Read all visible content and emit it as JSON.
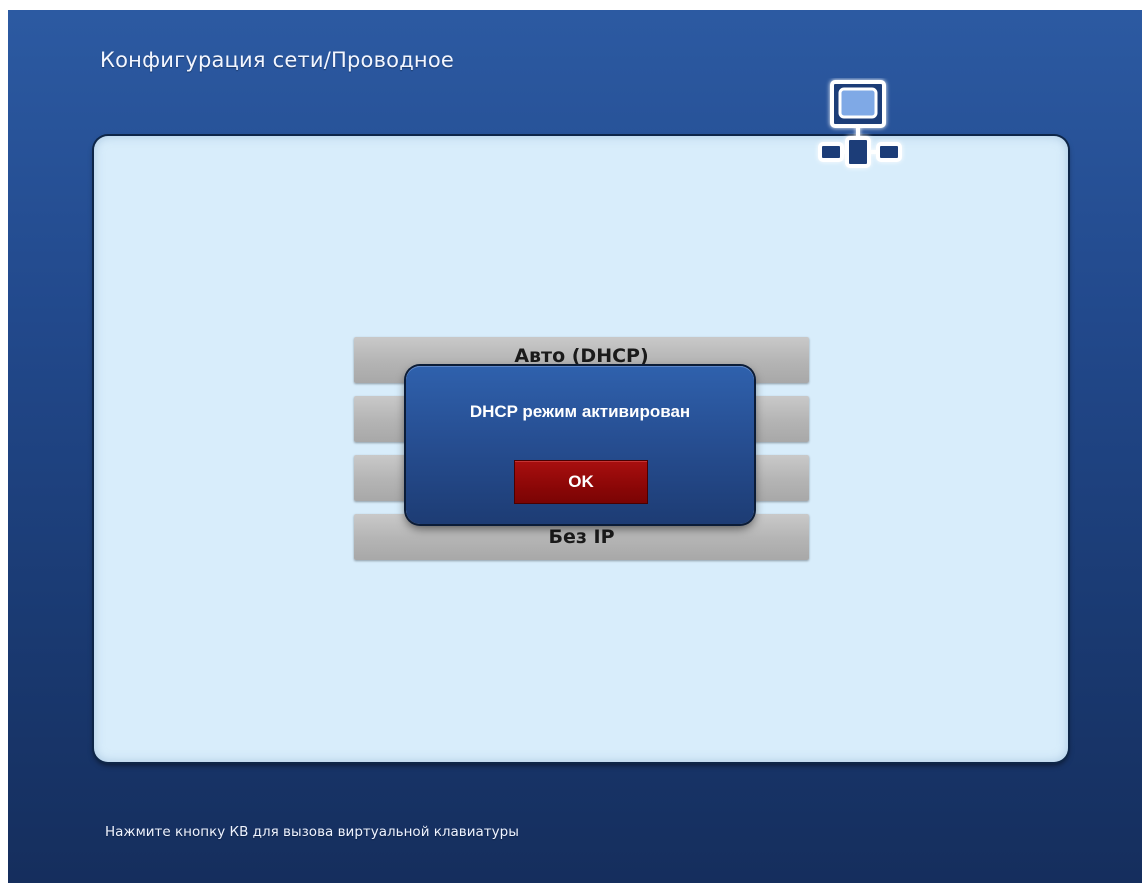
{
  "header": {
    "title": "Конфигурация сети/Проводное"
  },
  "icons": {
    "network": "network-computer-icon"
  },
  "menu": {
    "items": [
      {
        "label": "Авто (DHCP)"
      },
      {
        "label": ""
      },
      {
        "label": ""
      },
      {
        "label": "Без IP"
      }
    ]
  },
  "dialog": {
    "message": "DHCP режим активирован",
    "ok_label": "OK"
  },
  "footer": {
    "hint": "Нажмите кнопку КВ для вызова виртуальной клавиатуры"
  },
  "colors": {
    "background": "#22498c",
    "panel": "#d8edfb",
    "dialog": "#274f93",
    "ok_button": "#8c0707",
    "menu_item": "#b4b4b4"
  }
}
